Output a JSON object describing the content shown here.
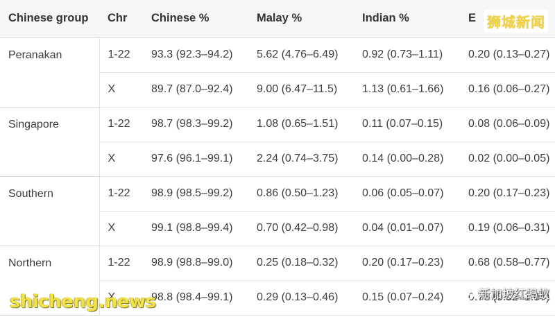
{
  "table": {
    "headers": [
      "Chinese group",
      "Chr",
      "Chinese %",
      "Malay %",
      "Indian %",
      "E"
    ],
    "groups": [
      {
        "name": "Peranakan",
        "rows": [
          [
            "1-22",
            "93.3 (92.3–94.2)",
            "5.62 (4.76–6.49)",
            "0.92 (0.73–1.11)",
            "0.20 (0.13–0.27)"
          ],
          [
            "X",
            "89.7 (87.0–92.4)",
            "9.00 (6.47–11.5)",
            "1.13 (0.61–1.66)",
            "0.16 (0.06–0.27)"
          ]
        ]
      },
      {
        "name": "Singapore",
        "rows": [
          [
            "1-22",
            "98.7 (98.3–99.2)",
            "1.08 (0.65–1.51)",
            "0.11 (0.07–0.15)",
            "0.08 (0.06–0.09)"
          ],
          [
            "X",
            "97.6 (96.1–99.1)",
            "2.24 (0.74–3.75)",
            "0.14 (0.00–0.28)",
            "0.02 (0.00–0.05)"
          ]
        ]
      },
      {
        "name": "Southern",
        "rows": [
          [
            "1-22",
            "98.9 (98.5–99.2)",
            "0.86 (0.50–1.23)",
            "0.06 (0.05–0.07)",
            "0.20 (0.17–0.23)"
          ],
          [
            "X",
            "99.1 (98.8–99.4)",
            "0.70 (0.42–0.98)",
            "0.04 (0.01–0.07)",
            "0.19 (0.06–0.31)"
          ]
        ]
      },
      {
        "name": "Northern",
        "rows": [
          [
            "1-22",
            "98.9 (98.8–99.0)",
            "0.25 (0.18–0.32)",
            "0.20 (0.17–0.23)",
            "0.68 (0.58–0.77)"
          ],
          [
            "X",
            "98.8 (98.4–99.1)",
            "0.29 (0.13–0.46)",
            "0.15 (0.07–0.24)",
            "0.73 (0.52–1.07)"
          ]
        ]
      }
    ]
  },
  "watermarks": {
    "top_right": "狮城新闻",
    "bottom_left": "shicheng.news",
    "bottom_right": "新加坡红蚂蚁",
    "bottom_right_icon": "wechat-icon"
  },
  "colors": {
    "header_bg": "#f6f6f6",
    "watermark_yellow": "#f2e24a"
  }
}
